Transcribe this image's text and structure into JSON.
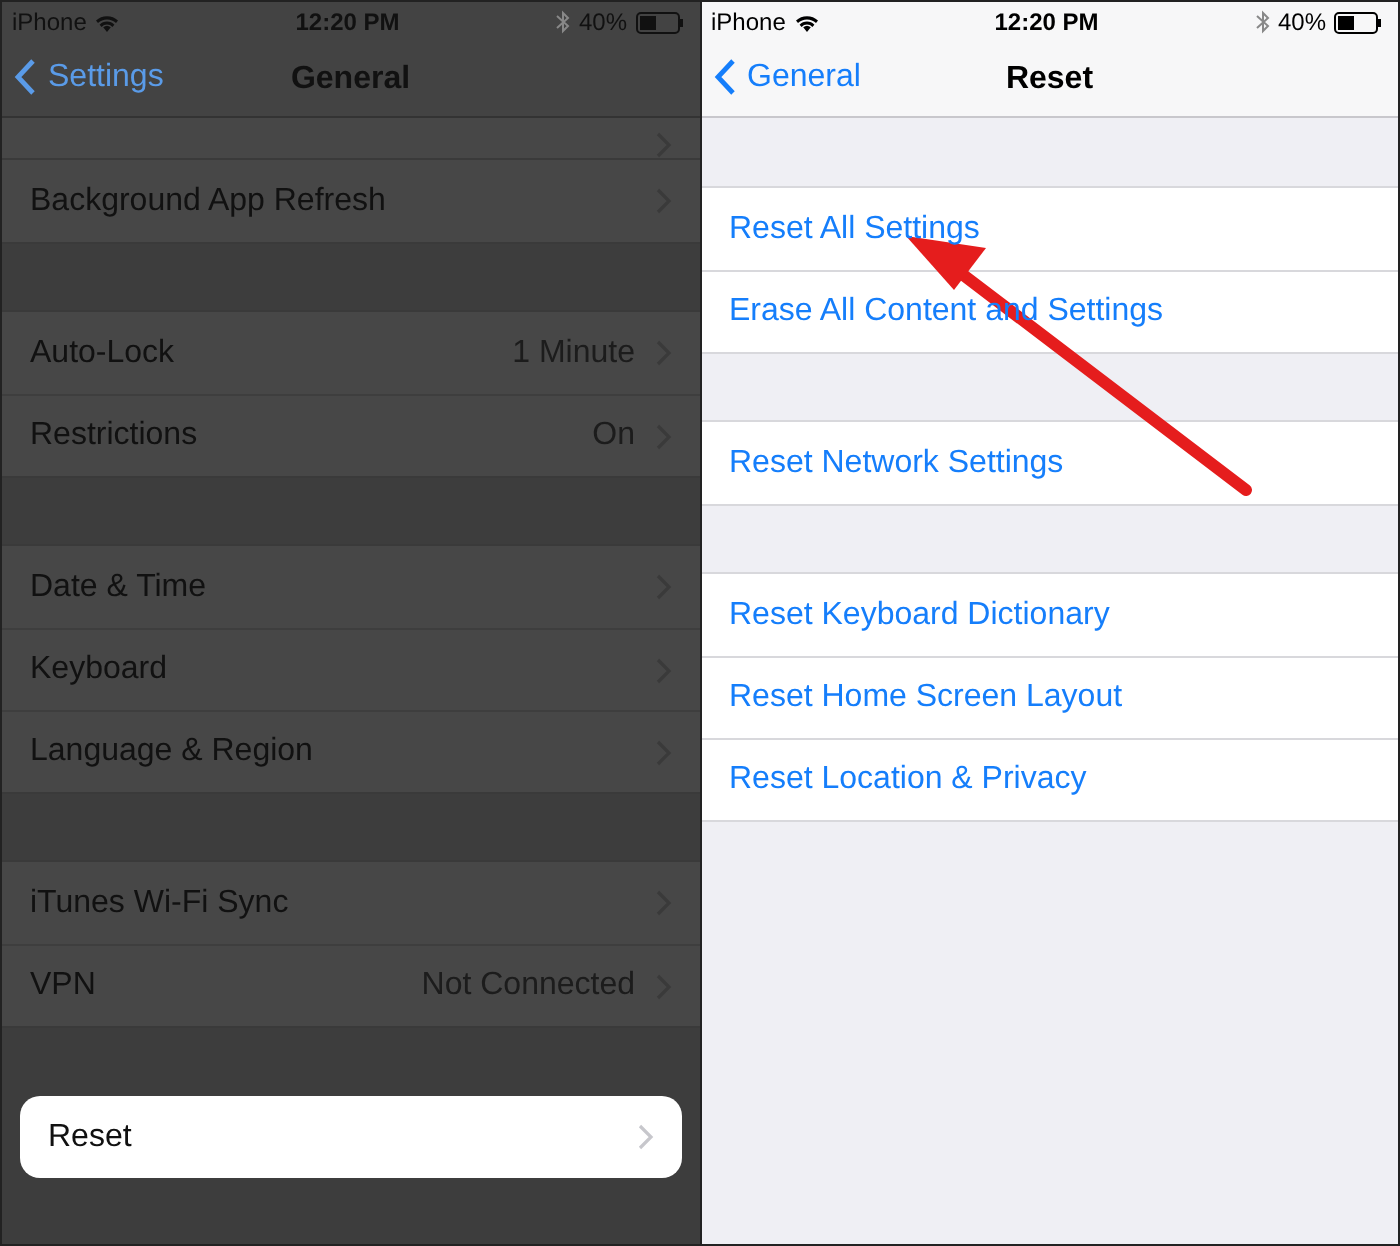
{
  "screens": [
    {
      "dimmed": true,
      "status_bar": {
        "carrier": "iPhone",
        "time": "12:20 PM",
        "battery": "40%"
      },
      "nav": {
        "back": "Settings",
        "title": "General"
      },
      "cut_row": true,
      "groups": [
        [
          {
            "label": "Background App Refresh",
            "selected": false
          }
        ],
        [
          {
            "label": "Auto-Lock",
            "value": "1 Minute",
            "selected": false
          },
          {
            "label": "Restrictions",
            "value": "On",
            "selected": false
          }
        ],
        [
          {
            "label": "Date & Time",
            "selected": false
          },
          {
            "label": "Keyboard",
            "selected": false
          },
          {
            "label": "Language & Region",
            "selected": false
          }
        ],
        [
          {
            "label": "iTunes Wi-Fi Sync",
            "selected": false
          },
          {
            "label": "VPN",
            "value": "Not Connected",
            "selected": false
          }
        ],
        [
          {
            "label": "Reset",
            "selected": true
          }
        ]
      ]
    },
    {
      "dimmed": false,
      "status_bar": {
        "carrier": "iPhone",
        "time": "12:20 PM",
        "battery": "40%"
      },
      "nav": {
        "back": "General",
        "title": "Reset"
      },
      "cut_row": false,
      "groups": [
        [
          {
            "label": "Reset All Settings",
            "kind": "action"
          },
          {
            "label": "Erase All Content and Settings",
            "kind": "action"
          }
        ],
        [
          {
            "label": "Reset Network Settings",
            "kind": "action"
          }
        ],
        [
          {
            "label": "Reset Keyboard Dictionary",
            "kind": "action"
          },
          {
            "label": "Reset Home Screen Layout",
            "kind": "action"
          },
          {
            "label": "Reset Location & Privacy",
            "kind": "action"
          }
        ]
      ]
    }
  ],
  "annotations": [
    {
      "kind": "arrow"
    }
  ]
}
